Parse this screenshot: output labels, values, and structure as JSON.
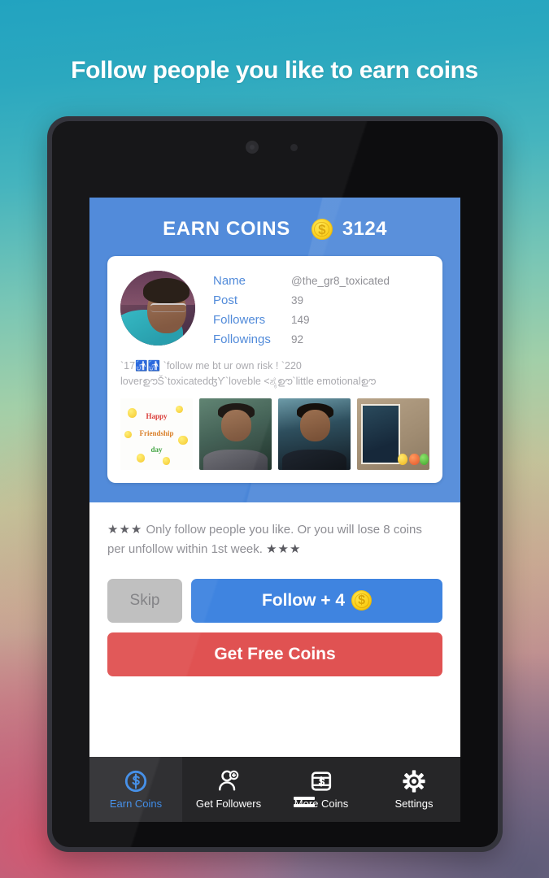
{
  "headline": "Follow people you like to earn coins",
  "app": {
    "title": "EARN COINS",
    "coin_balance": "3124",
    "coin_symbol": "$"
  },
  "profile": {
    "avatar_alt": "user-avatar",
    "stats": [
      {
        "label": "Name",
        "value": "@the_gr8_toxicated"
      },
      {
        "label": "Post",
        "value": "39"
      },
      {
        "label": "Followers",
        "value": "149"
      },
      {
        "label": "Followings",
        "value": "92"
      }
    ],
    "bio": "`17🚮🚮 `follow me bt ur own risk ! `220 loverഊŠ`toxicatedʤϒ`loveble <ಶೈഊ`little emotionalഊ",
    "photos": [
      {
        "name": "photo-happy-friendship-day",
        "caption_line1": "Happy",
        "caption_line2": "Friendship",
        "caption_line3": "day"
      },
      {
        "name": "photo-portrait-green"
      },
      {
        "name": "photo-portrait-road"
      },
      {
        "name": "photo-collage-stickers"
      }
    ]
  },
  "notice": {
    "stars_left": "★★★",
    "text": " Only follow people you like. Or you will lose 8 coins per unfollow within 1st week. ",
    "stars_right": "★★★"
  },
  "actions": {
    "skip_label": "Skip",
    "follow_label": "Follow + 4",
    "get_free_coins_label": "Get Free Coins"
  },
  "bottom_nav": [
    {
      "id": "earn-coins",
      "label": "Earn Coins",
      "icon": "coin-dollar-icon",
      "active": true
    },
    {
      "id": "get-followers",
      "label": "Get Followers",
      "icon": "person-add-icon",
      "active": false
    },
    {
      "id": "more-coins",
      "label": "More Coins",
      "icon": "coin-box-icon",
      "active": false
    },
    {
      "id": "settings",
      "label": "Settings",
      "icon": "gear-icon",
      "active": false
    }
  ],
  "colors": {
    "accent_blue": "#4a86d8",
    "coin_yellow": "#fcd11b",
    "danger_red": "#e05252",
    "skip_gray": "#bdbdbd",
    "nav_bg": "#262628"
  }
}
